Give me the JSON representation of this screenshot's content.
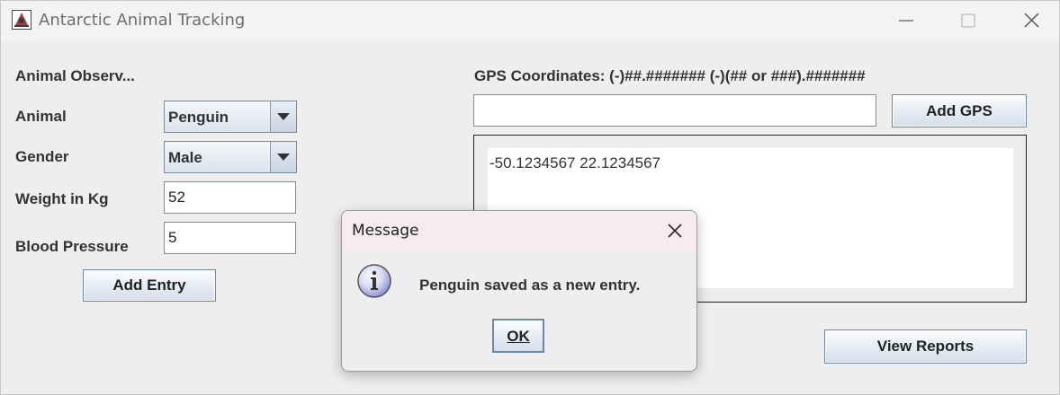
{
  "window": {
    "title": "Antarctic Animal Tracking"
  },
  "form": {
    "section_title": "Animal Observ...",
    "animal_label": "Animal",
    "animal_value": "Penguin",
    "gender_label": "Gender",
    "gender_value": "Male",
    "weight_label": "Weight in Kg",
    "weight_value": "52",
    "bp_label": "Blood Pressure",
    "bp_value": "5",
    "add_entry_label": "Add Entry"
  },
  "gps": {
    "label": "GPS Coordinates: (-)##.####### (-)(## or ###).#######",
    "input_value": "",
    "add_gps_label": "Add GPS",
    "entries": [
      "-50.1234567 22.1234567"
    ]
  },
  "view_reports_label": "View Reports",
  "dialog": {
    "title": "Message",
    "message": "Penguin saved as a new entry.",
    "ok_label": "OK"
  },
  "colors": {
    "button_border": "#6d87a8",
    "dialog_titlebar": "#f6ecf0",
    "window_bg": "#eeeeee"
  },
  "icons": [
    "java-app-icon",
    "minimize-icon",
    "maximize-icon",
    "close-icon",
    "chevron-down-icon",
    "info-icon"
  ]
}
